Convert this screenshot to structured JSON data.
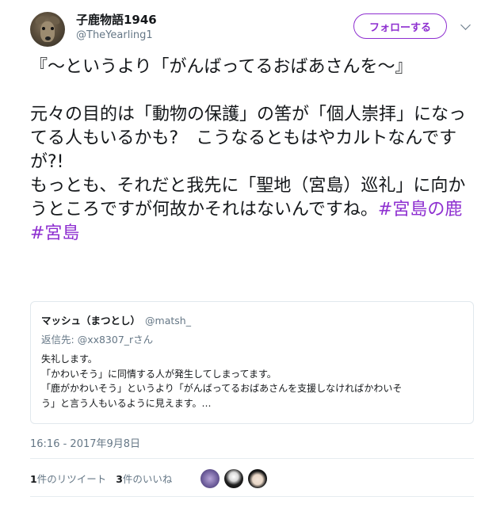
{
  "author": {
    "display_name": "子鹿物語1946",
    "handle": "@TheYearling1"
  },
  "follow_button": {
    "label": "フォローする"
  },
  "icons": {
    "more": "chevron-down-icon",
    "avatar": "deer-avatar"
  },
  "tweet": {
    "line1": "『～というより「がんばってるおばあさんを～』",
    "line2": "元々の目的は「動物の保護」の筈が「個人崇拝」になってる人もいるかも?　こうなるともはやカルトなんですが?!",
    "line3_text": "もっとも、それだと我先に「聖地（宮島）巡礼」に向かうところですが何故かそれはないんですね。",
    "hashtag1": "#宮島の鹿",
    "hashtag2": "#宮島"
  },
  "quote": {
    "name": "マッシュ（まつとし）",
    "handle": "@matsh_",
    "reply_prefix": "返信先: ",
    "reply_to": "@xx8307_rさん",
    "body_lines": [
      "失礼します。",
      "「かわいそう」に同情する人が発生してしまってます。",
      "「鹿がかわいそう」というより「がんばってるおばあさんを支援しなければかわいそ",
      "う」と言う人もいるように見えます。…"
    ]
  },
  "timestamp": "16:16 - 2017年9月8日",
  "stats": {
    "retweet_count": "1",
    "retweet_label": "件のリツイート",
    "like_count": "3",
    "like_label": "件のいいね"
  },
  "colors": {
    "accent": "#8e2fd0",
    "secondary_text": "#657786",
    "border": "#e1e8ed"
  }
}
